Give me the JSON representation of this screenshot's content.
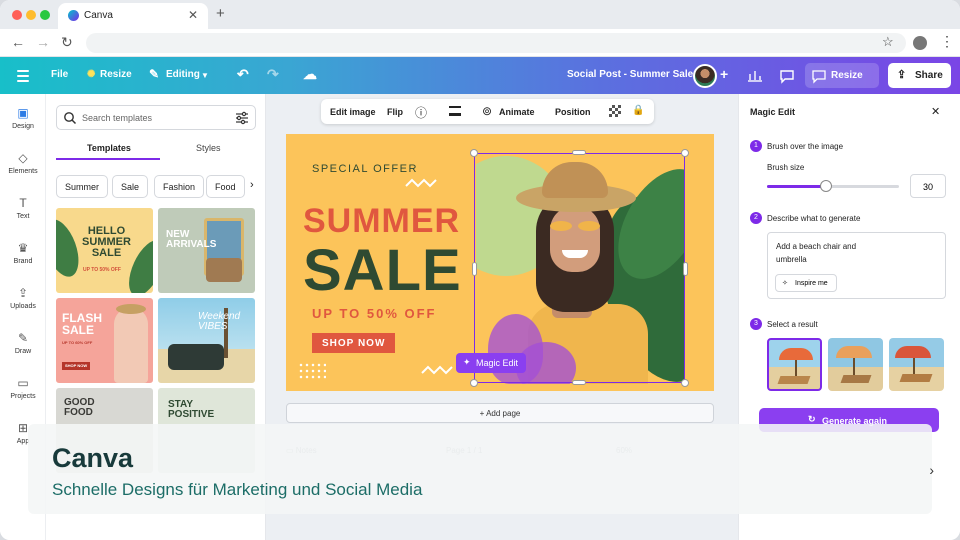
{
  "browser": {
    "tab_title": "Canva",
    "close_glyph": "✕",
    "new_tab_glyph": "+",
    "back_glyph": "←",
    "forward_glyph": "→",
    "reload_glyph": "↻",
    "bookmark_glyph": "☆",
    "menu_glyph": "⋮"
  },
  "header": {
    "file": "File",
    "resize": "Resize",
    "editing": "Editing",
    "undo_glyph": "↶",
    "redo_glyph": "↷",
    "cloud_glyph": "☁",
    "doc_title": "Social Post - Summer Sale",
    "add_glyph": "+",
    "resize_right": "Resize",
    "share": "Share",
    "colors": {
      "teal": "#18bfc9",
      "purple": "#7a45e6"
    }
  },
  "rail": {
    "items": [
      {
        "label": "Design",
        "icon": "design-icon",
        "glyph": "▣"
      },
      {
        "label": "Elements",
        "icon": "elements-icon",
        "glyph": "◇"
      },
      {
        "label": "Text",
        "icon": "text-icon",
        "glyph": "T"
      },
      {
        "label": "Brand",
        "icon": "brand-icon",
        "glyph": "♛"
      },
      {
        "label": "Uploads",
        "icon": "cloud-upload-icon",
        "glyph": "⇪"
      },
      {
        "label": "Draw",
        "icon": "pen-icon",
        "glyph": "✎"
      },
      {
        "label": "Projects",
        "icon": "folder-icon",
        "glyph": "▭"
      },
      {
        "label": "App",
        "icon": "apps-icon",
        "glyph": "⊞"
      }
    ]
  },
  "templates": {
    "search_placeholder": "Search templates",
    "tabs": [
      "Templates",
      "Styles"
    ],
    "chips": [
      "Summer",
      "Sale",
      "Fashion",
      "Food"
    ],
    "thumbs": [
      {
        "title": "HELLO SUMMER SALE",
        "sub": "UP TO 50% OFF"
      },
      {
        "title": "NEW ARRIVALS"
      },
      {
        "title": "FLASH SALE",
        "sub": "UP TO 60% OFF",
        "cta": "SHOP NOW"
      },
      {
        "title": "Weekend VIBES"
      },
      {
        "title": "GOOD FOOD"
      },
      {
        "title": "STAY POSITIVE"
      }
    ]
  },
  "canvas_toolbar": {
    "edit_image": "Edit image",
    "flip": "Flip",
    "info_glyph": "ⓘ",
    "animate": "Animate",
    "position": "Position",
    "lock_glyph": "🔒"
  },
  "design": {
    "special_offer": "SPECIAL OFFER",
    "summer": "SUMMER",
    "sale": "SALE",
    "discount": "UP TO 50% OFF",
    "cta": "SHOP NOW",
    "magic_edit": "Magic Edit",
    "add_page": "+ Add page",
    "colors": {
      "background": "#fcc45a",
      "red": "#e0573f",
      "green": "#2f4a32",
      "selection": "#7d2ae8"
    }
  },
  "magic_edit": {
    "title": "Magic Edit",
    "close_glyph": "✕",
    "step1": "Brush over the image",
    "brush_size_label": "Brush size",
    "brush_size": "30",
    "brush_fraction": 0.45,
    "step2": "Describe what to generate",
    "prompt": "Add a beach chair and umbrella",
    "inspire": "Inspire me",
    "step3": "Select a result",
    "generate_again": "Generate again",
    "step_numbers": [
      "1",
      "2",
      "3"
    ]
  },
  "overlay": {
    "title": "Canva",
    "subtitle": "Schnelle Designs für Marketing und Social Media"
  }
}
